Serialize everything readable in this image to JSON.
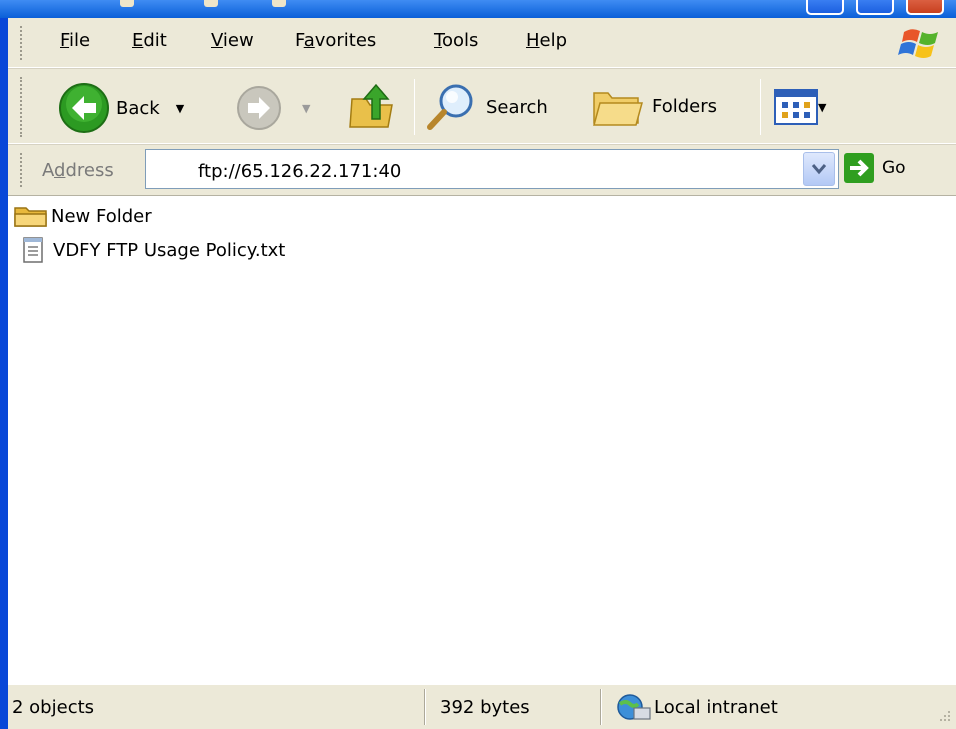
{
  "menubar": {
    "items": [
      {
        "label": "File",
        "accel": "F",
        "rest": "ile"
      },
      {
        "label": "Edit",
        "accel": "E",
        "rest": "dit"
      },
      {
        "label": "View",
        "accel": "V",
        "rest": "iew"
      },
      {
        "label": "Favorites",
        "pre": "F",
        "accel": "a",
        "rest": "vorites"
      },
      {
        "label": "Tools",
        "accel": "T",
        "rest": "ools"
      },
      {
        "label": "Help",
        "accel": "H",
        "rest": "elp"
      }
    ]
  },
  "toolbar": {
    "back_label": "Back",
    "search_label": "Search",
    "folders_label": "Folders"
  },
  "address": {
    "label_pre": "A",
    "label_accel": "d",
    "label_post": "dress",
    "value": "ftp://65.126.22.171:40",
    "go_label": "Go"
  },
  "files": [
    {
      "name": "New Folder",
      "icon": "folder-icon"
    },
    {
      "name": "VDFY FTP Usage Policy.txt",
      "icon": "text-file-icon"
    }
  ],
  "status": {
    "objects": "2 objects",
    "size": "392 bytes",
    "zone": "Local intranet"
  },
  "colors": {
    "frame": "#0847d8",
    "chrome": "#ece9d8",
    "go_green": "#2f9e1f"
  }
}
